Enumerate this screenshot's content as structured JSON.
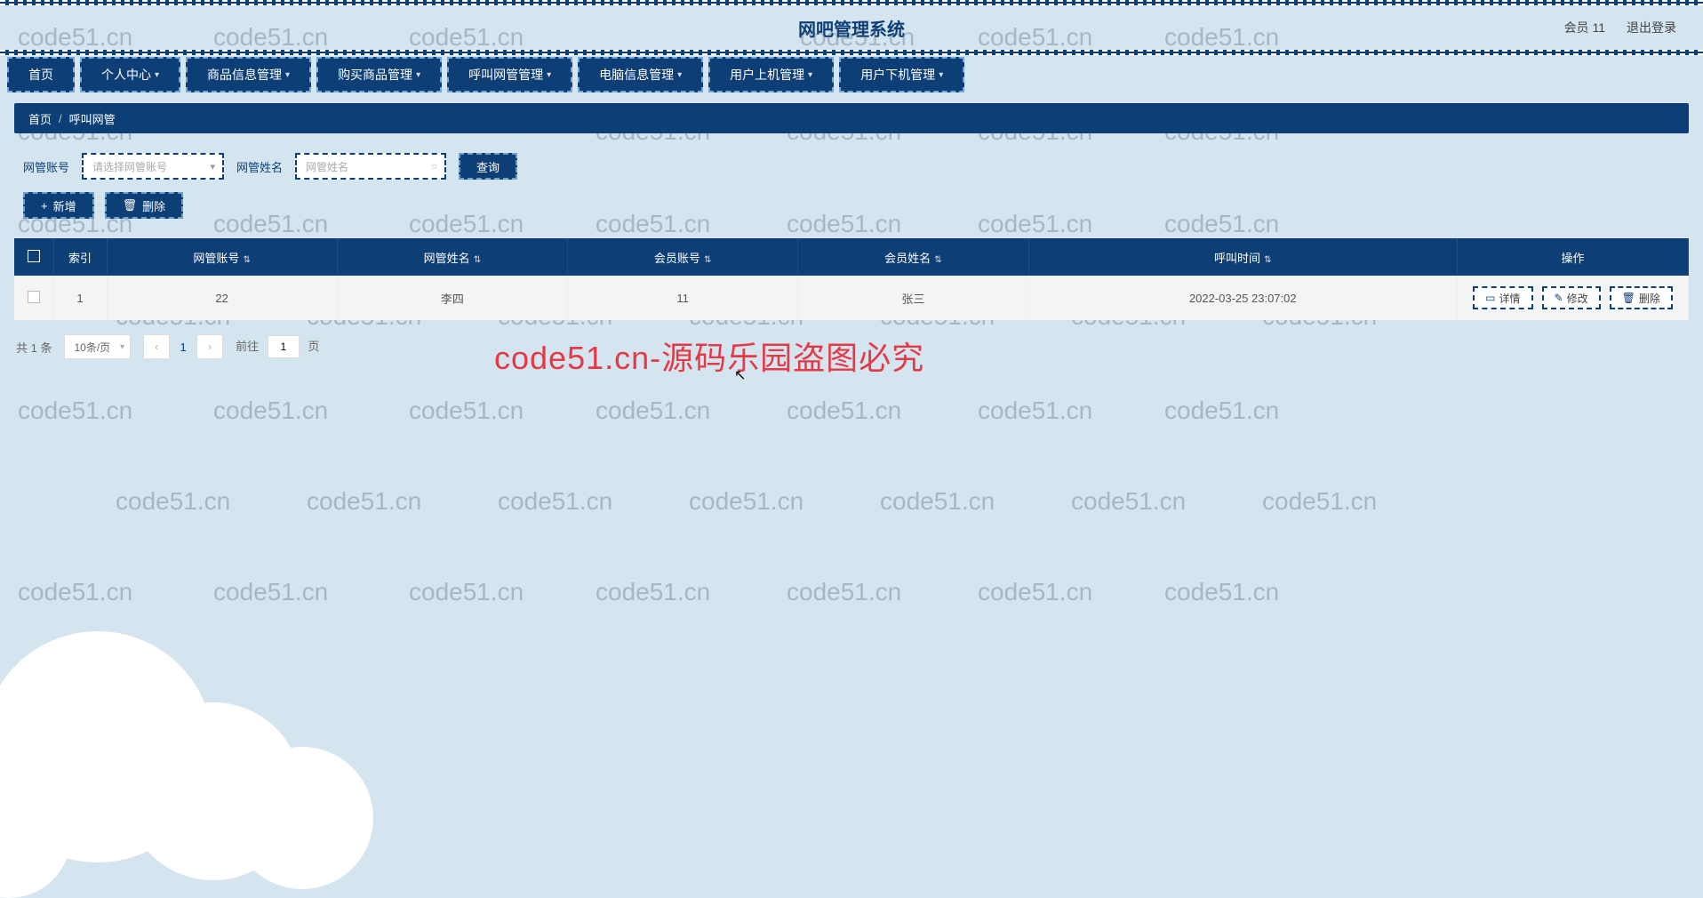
{
  "header": {
    "title": "网吧管理系统",
    "member_label": "会员 11",
    "logout_label": "退出登录"
  },
  "nav": [
    {
      "label": "首页",
      "dropdown": false
    },
    {
      "label": "个人中心",
      "dropdown": true
    },
    {
      "label": "商品信息管理",
      "dropdown": true
    },
    {
      "label": "购买商品管理",
      "dropdown": true
    },
    {
      "label": "呼叫网管管理",
      "dropdown": true
    },
    {
      "label": "电脑信息管理",
      "dropdown": true
    },
    {
      "label": "用户上机管理",
      "dropdown": true
    },
    {
      "label": "用户下机管理",
      "dropdown": true
    }
  ],
  "breadcrumb": {
    "home": "首页",
    "current": "呼叫网管"
  },
  "filters": {
    "account_label": "网管账号",
    "account_placeholder": "请选择网管账号",
    "name_label": "网管姓名",
    "name_placeholder": "网管姓名",
    "search_label": "查询"
  },
  "actions": {
    "add_label": "新增",
    "delete_label": "删除"
  },
  "table": {
    "headers": {
      "index": "索引",
      "account": "网管账号",
      "admin_name": "网管姓名",
      "member_account": "会员账号",
      "member_name": "会员姓名",
      "call_time": "呼叫时间",
      "operate": "操作"
    },
    "rows": [
      {
        "index": "1",
        "account": "22",
        "admin_name": "李四",
        "member_account": "11",
        "member_name": "张三",
        "call_time": "2022-03-25 23:07:02"
      }
    ],
    "row_actions": {
      "detail": "详情",
      "edit": "修改",
      "delete": "删除"
    }
  },
  "pagination": {
    "total_text": "共 1 条",
    "page_size_label": "10条/页",
    "current": "1",
    "jump_prefix": "前往",
    "jump_value": "1",
    "jump_suffix": "页"
  },
  "watermark": {
    "text": "code51.cn",
    "red": "code51.cn-源码乐园盗图必究"
  }
}
